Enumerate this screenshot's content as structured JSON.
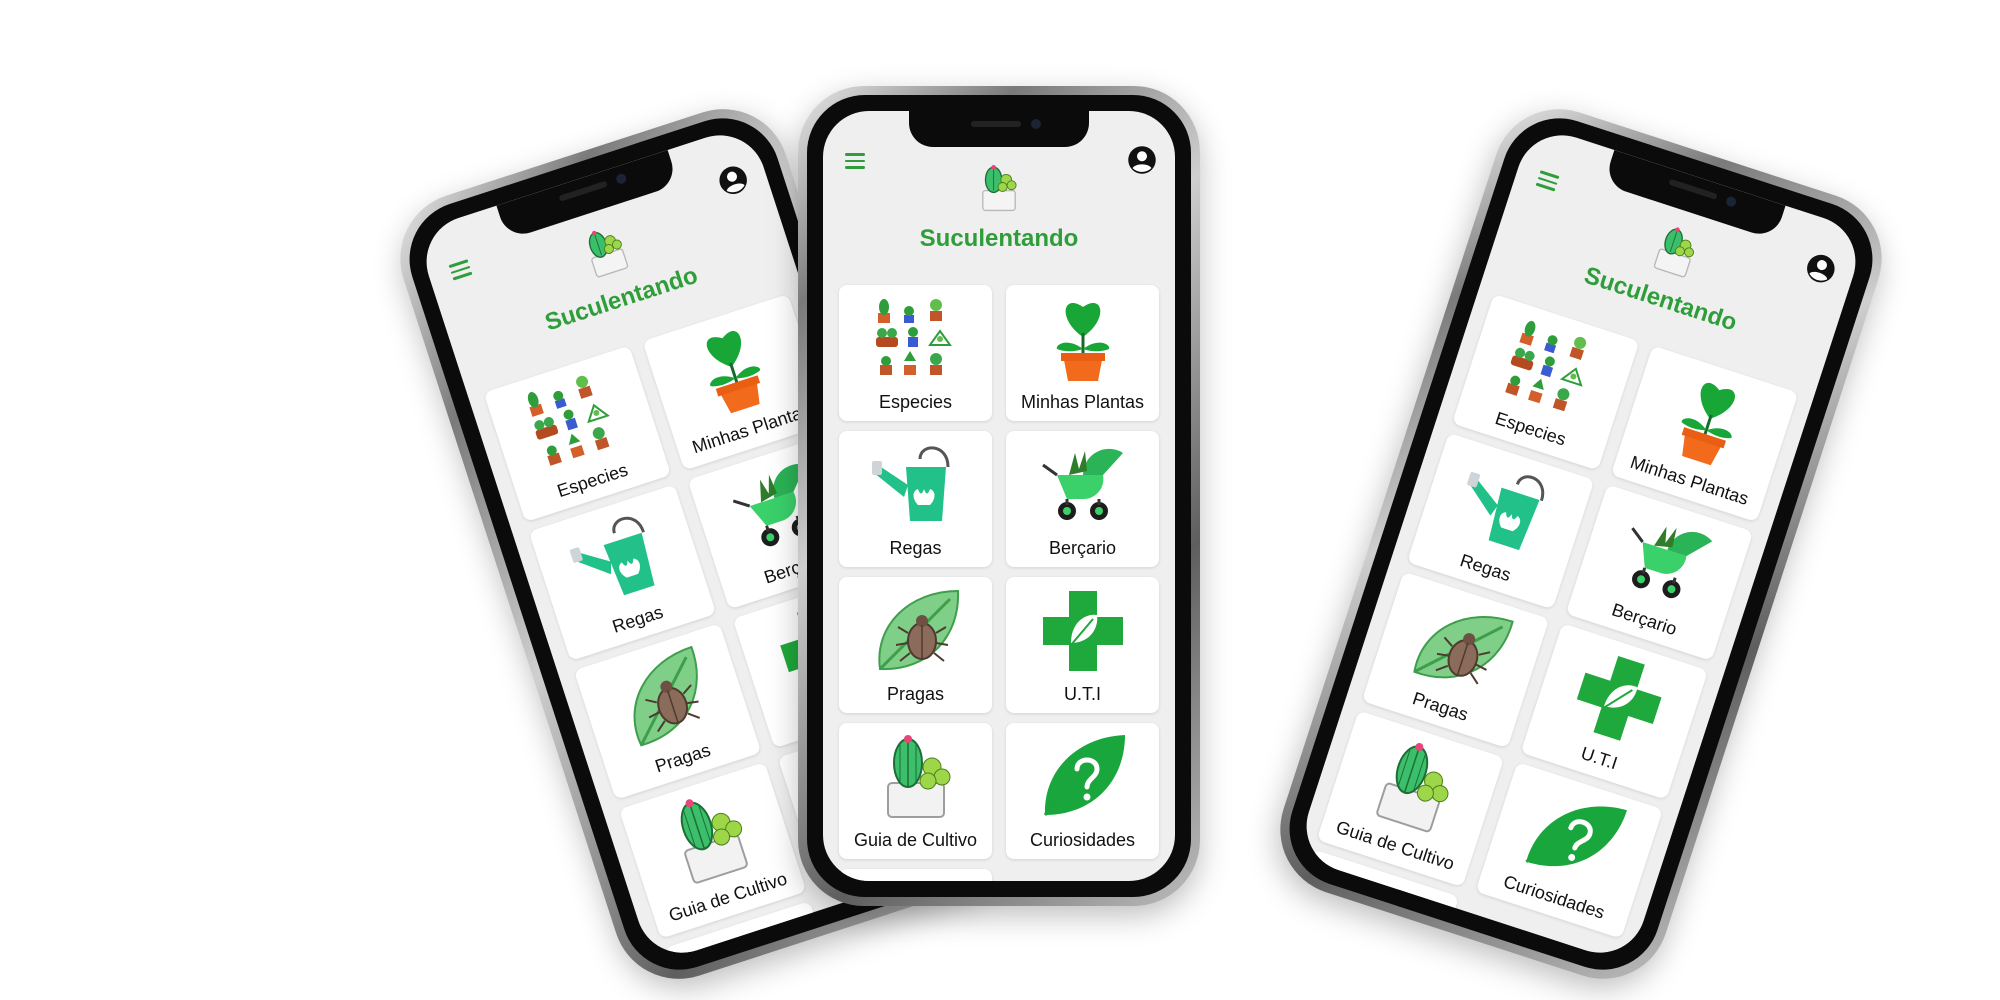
{
  "app": {
    "title": "Suculentando",
    "colors": {
      "brand_green": "#2f9e3a",
      "card_bg": "#ffffff",
      "screen_bg": "#efefef"
    },
    "menu_icon": "hamburger-menu-icon",
    "profile_icon": "account-circle-icon",
    "menu": [
      {
        "label": "Especies",
        "icon": "succulent-collection-icon"
      },
      {
        "label": "Minhas Plantas",
        "icon": "potted-heart-plant-icon"
      },
      {
        "label": "Regas",
        "icon": "watering-can-icon"
      },
      {
        "label": "Berçario",
        "icon": "plant-stroller-icon"
      },
      {
        "label": "Pragas",
        "icon": "leaf-beetle-icon"
      },
      {
        "label": "U.T.I",
        "icon": "green-cross-leaf-icon"
      },
      {
        "label": "Guia de Cultivo",
        "icon": "succulent-pot-icon"
      },
      {
        "label": "Curiosidades",
        "icon": "question-leaf-icon"
      }
    ]
  }
}
